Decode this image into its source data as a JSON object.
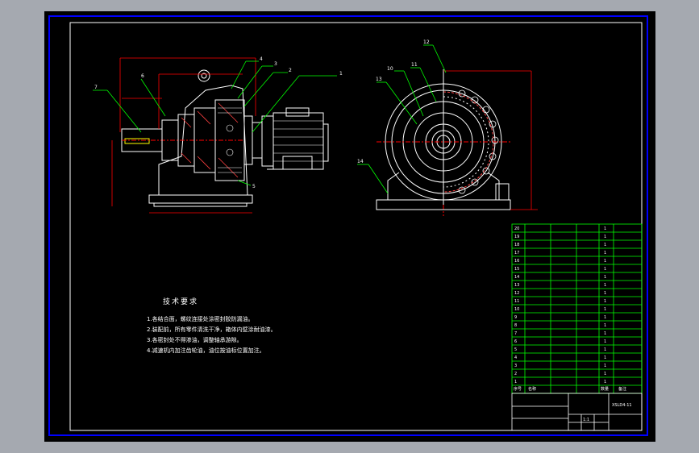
{
  "drawing": {
    "notes_title": "技术要求",
    "notes": [
      "1.各结合面，螺纹连接处涂密封胶防漏油。",
      "2.装配前，所有零件清洗干净，箱体内壁涂耐油漆。",
      "3.各密封处不得渗油，调整轴承游隙。",
      "4.减速机内加注齿轮油，油位按油标位置加注。"
    ],
    "callouts_side": [
      "1",
      "2",
      "3",
      "4",
      "5",
      "6",
      "7"
    ],
    "callouts_front": [
      "10",
      "11",
      "12",
      "13",
      "14"
    ],
    "bom_rows": [
      {
        "no": "20",
        "qty": "1"
      },
      {
        "no": "19",
        "qty": "1"
      },
      {
        "no": "18",
        "qty": "1"
      },
      {
        "no": "17",
        "qty": "1"
      },
      {
        "no": "16",
        "qty": "1"
      },
      {
        "no": "15",
        "qty": "1"
      },
      {
        "no": "14",
        "qty": "1"
      },
      {
        "no": "13",
        "qty": "1"
      },
      {
        "no": "12",
        "qty": "1"
      },
      {
        "no": "11",
        "qty": "1"
      },
      {
        "no": "10",
        "qty": "1"
      },
      {
        "no": "9",
        "qty": "1"
      },
      {
        "no": "8",
        "qty": "1"
      },
      {
        "no": "7",
        "qty": "1"
      },
      {
        "no": "6",
        "qty": "1"
      },
      {
        "no": "5",
        "qty": "1"
      },
      {
        "no": "4",
        "qty": "1"
      },
      {
        "no": "3",
        "qty": "1"
      },
      {
        "no": "2",
        "qty": "1"
      },
      {
        "no": "1",
        "qty": "1"
      }
    ],
    "bom_header": {
      "no": "序号",
      "name": "名称",
      "qty": "数量",
      "note": "备注"
    },
    "title_block": {
      "drawing_no": "XSLD4-11",
      "scale": "1:1"
    }
  },
  "colors": {
    "line": "#ffffff",
    "dim": "#ff0000",
    "leader": "#00ff00",
    "hidden": "#ffff00",
    "frame": "#0000ff",
    "table": "#00ff00"
  }
}
